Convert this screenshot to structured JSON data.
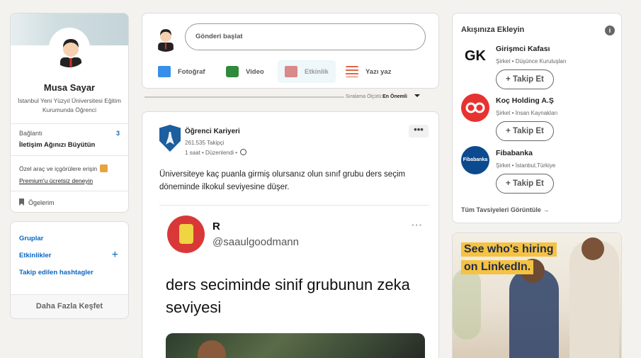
{
  "profile": {
    "name": "Musa Sayar",
    "description": "İstanbul Yeni Yüzyıl Üniversitesi Eğitim Kurumunda Öğrenci",
    "connections_label": "Bağlantı",
    "connections_count": "3",
    "connections_sub": "İletişim Ağınızı Büyütün",
    "premium_text": "Özel araç ve içgörülere erişin",
    "premium_link": "Premium'u ücretsiz deneyin",
    "saved_items": "Ögelerim"
  },
  "discover": {
    "links": [
      "Gruplar",
      "Etkinlikler",
      "Takip edilen hashtagler"
    ],
    "more": "Daha Fazla Keşfet"
  },
  "composer": {
    "placeholder": "Gönderi başlat",
    "actions": [
      {
        "label": "Fotoğraf",
        "icon": "photo-icon",
        "color": "#378fe9"
      },
      {
        "label": "Video",
        "icon": "video-icon",
        "color": "#5f9b41"
      },
      {
        "label": "Etkinlik",
        "icon": "calendar-icon",
        "color": "#c37d16"
      },
      {
        "label": "Yazı yaz",
        "icon": "article-icon",
        "color": "#e06847"
      }
    ]
  },
  "sort": {
    "label": "Sıralama Ölçütü:",
    "value": "En Önemli"
  },
  "post": {
    "author": "Öğrenci Kariyeri",
    "followers": "261.535 Takipçi",
    "time": "1 saat • Düzenlendi •",
    "text": "Üniversiteye kaç puanla girmiş olursanız olun sınıf grubu ders seçim döneminde ilkokul seviyesine düşer.",
    "tweet": {
      "name": "R",
      "handle": "@saaulgoodmann",
      "text": "ders seciminde sinif grubunun zeka seviyesi"
    }
  },
  "suggestions": {
    "title": "Akışınıza Ekleyin",
    "follow_label": "+ Takip Et",
    "items": [
      {
        "name": "Girişmci Kafası",
        "meta": "Şirket • Düşünce Kuruluşları",
        "logo_text": "GK"
      },
      {
        "name": "Koç Holding A.Ş",
        "meta": "Şirket • İnsan Kaynakları",
        "logo_text": ""
      },
      {
        "name": "Fibabanka",
        "meta": "Şirket • İstanbul,Türkiye",
        "logo_text": "Fibabanka"
      }
    ],
    "all_link": "Tüm Tavsiyeleri Görüntüle →"
  },
  "ad": {
    "line1": "See who's hiring",
    "line2": "on LinkedIn."
  }
}
